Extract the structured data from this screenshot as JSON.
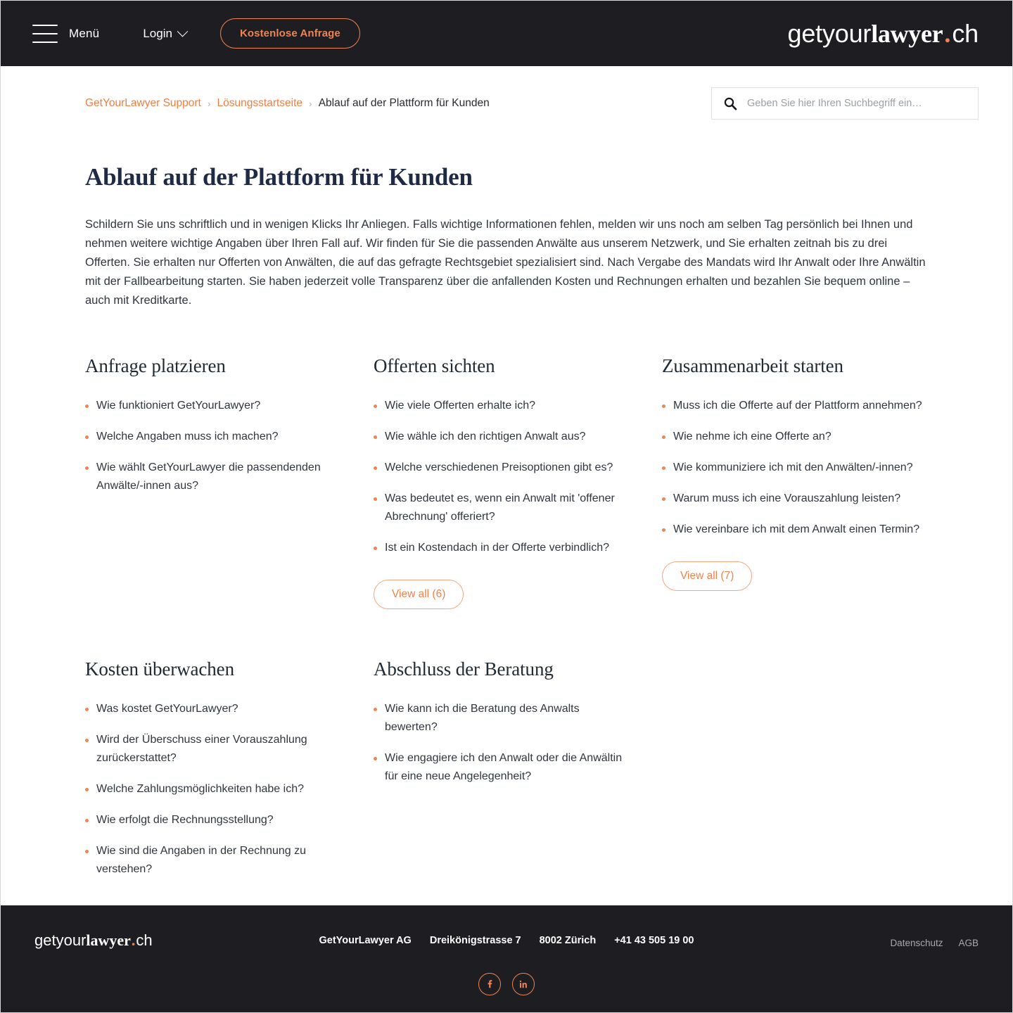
{
  "header": {
    "menu_label": "Menü",
    "login_label": "Login",
    "cta_label": "Kostenlose Anfrage",
    "logo": {
      "part1": "getyour",
      "part2": "lawyer",
      "dot": ".",
      "part3": "ch"
    },
    "background": "#1e1e22",
    "accent": "#ef8354"
  },
  "breadcrumb": {
    "item1": "GetYourLawyer Support",
    "sep1": "›",
    "item2": "Lösungsstartseite",
    "sep2": "›",
    "current": "Ablauf auf der Plattform für Kunden"
  },
  "search": {
    "placeholder": "Geben Sie hier Ihren Suchbegriff ein…",
    "value": "",
    "icon": "search-icon"
  },
  "main": {
    "title": "Ablauf auf der Plattform für Kunden",
    "intro": "Schildern Sie uns schriftlich und in wenigen Klicks Ihr Anliegen. Falls wichtige Informationen fehlen, melden wir uns noch am selben Tag persönlich bei Ihnen und nehmen weitere wichtige Angaben über Ihren Fall auf. Wir finden für Sie die passenden Anwälte aus unserem Netzwerk, und Sie erhalten zeitnah bis zu drei Offerten. Sie erhalten nur Offerten von Anwälten, die auf das gefragte Rechtsgebiet spezialisiert sind. Nach Vergabe des Mandats wird Ihr Anwalt oder Ihre Anwältin mit der Fallbearbeitung starten. Sie haben jederzeit volle Transparenz über die anfallenden Kosten und Rechnungen erhalten und bezahlen Sie bequem online – auch mit Kreditkarte.",
    "categories": [
      {
        "title": "Anfrage platzieren",
        "items": [
          "Wie funktioniert GetYourLawyer?",
          "Welche Angaben muss ich machen?",
          "Wie wählt GetYourLawyer die passendenden Anwälte/-innen aus?"
        ],
        "view_all": null
      },
      {
        "title": "Offerten sichten",
        "items": [
          "Wie viele Offerten erhalte ich?",
          "Wie wähle ich den richtigen Anwalt aus?",
          "Welche verschiedenen Preisoptionen gibt es?",
          "Was bedeutet es, wenn ein Anwalt mit 'offener Abrechnung' offeriert?",
          "Ist ein Kostendach in der Offerte verbindlich?"
        ],
        "view_all": "View all (6)"
      },
      {
        "title": "Zusammenarbeit starten",
        "items": [
          "Muss ich die Offerte auf der Plattform annehmen?",
          "Wie nehme ich eine Offerte an?",
          "Wie kommuniziere ich mit den Anwälten/-innen?",
          "Warum muss ich eine Vorauszahlung leisten?",
          "Wie vereinbare ich mit dem Anwalt einen Termin?"
        ],
        "view_all": "View all (7)"
      },
      {
        "title": "Kosten überwachen",
        "items": [
          "Was kostet GetYourLawyer?",
          "Wird der Überschuss einer Vorauszahlung zurückerstattet?",
          "Welche Zahlungsmöglichkeiten habe ich?",
          "Wie erfolgt die Rechnungsstellung?",
          "Wie sind die Angaben in der Rechnung zu verstehen?"
        ],
        "view_all": null
      },
      {
        "title": "Abschluss der Beratung",
        "items": [
          "Wie kann ich die Beratung des Anwalts bewerten?",
          "Wie engagiere ich den Anwalt oder die Anwältin für eine neue Angelegenheit?"
        ],
        "view_all": null
      }
    ]
  },
  "footer": {
    "logo": {
      "part1": "getyour",
      "part2": "lawyer",
      "dot": ".",
      "part3": "ch"
    },
    "company": "GetYourLawyer AG",
    "street": "Dreikönigstrasse 7",
    "city": "8002 Zürich",
    "phone": "+41 43 505 19 00",
    "links": [
      "Datenschutz",
      "AGB"
    ],
    "socials": [
      "facebook-icon",
      "linkedin-icon"
    ]
  }
}
